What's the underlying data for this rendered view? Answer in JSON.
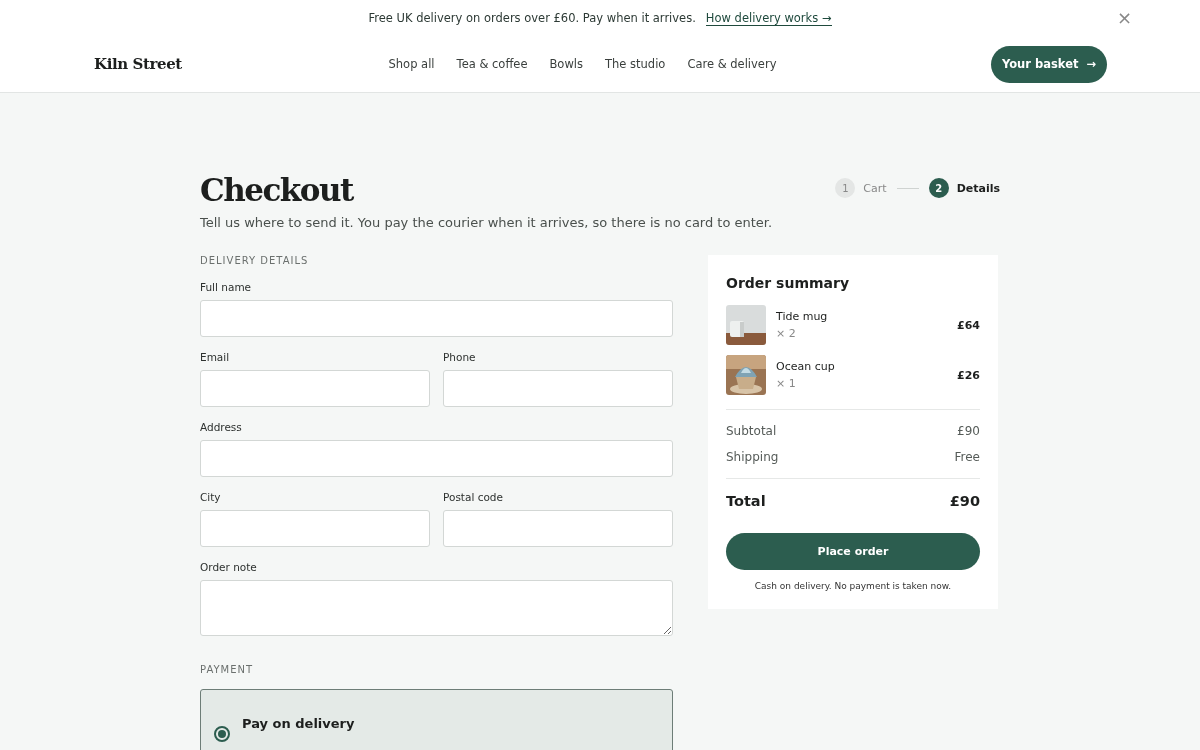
{
  "announcement": {
    "text": "Free UK delivery on orders over £60. Pay when it arrives.",
    "link": "How delivery works →",
    "close": "×"
  },
  "header": {
    "logo": "Kiln Street",
    "nav": [
      {
        "label": "Shop all"
      },
      {
        "label": "Tea & coffee"
      },
      {
        "label": "Bowls"
      },
      {
        "label": "The studio"
      },
      {
        "label": "Care & delivery"
      }
    ],
    "basket": "Your basket",
    "basket_arrow": "→"
  },
  "checkout": {
    "title": "Checkout",
    "subtitle": "Tell us where to send it. You pay the courier when it arrives, so there is no card to enter.",
    "steps": [
      {
        "number": "1",
        "label": "Cart",
        "selected": false
      },
      {
        "number": "2",
        "label": "Details",
        "selected": true
      }
    ],
    "delivery_heading": "DELIVERY DETAILS",
    "fields": [
      {
        "label": "Full name",
        "kind": "wide"
      },
      {
        "label": "Email",
        "kind": "half"
      },
      {
        "label": "Phone",
        "kind": "half"
      },
      {
        "label": "Address",
        "kind": "wide"
      },
      {
        "label": "City",
        "kind": "half"
      },
      {
        "label": "Postal code",
        "kind": "half"
      },
      {
        "label": "Order note",
        "kind": "textarea"
      }
    ],
    "payment": {
      "heading": "PAYMENT",
      "options": [
        {
          "label": "Pay on delivery",
          "selected": true
        }
      ]
    }
  },
  "summary": {
    "title": "Order summary",
    "items": [
      {
        "name": "Tide mug",
        "quantity": "× 2",
        "price": "£64",
        "kind": "picture"
      },
      {
        "name": "Ocean cup",
        "quantity": "× 1",
        "price": "£26",
        "kind": "picture"
      }
    ],
    "lines": [
      {
        "label": "Subtotal",
        "value": "£90"
      },
      {
        "label": "Shipping",
        "value": "Free"
      }
    ],
    "total": {
      "label": "Total",
      "value": "£90"
    },
    "button": "Place order",
    "note": "Cash on delivery. No payment is taken now."
  }
}
